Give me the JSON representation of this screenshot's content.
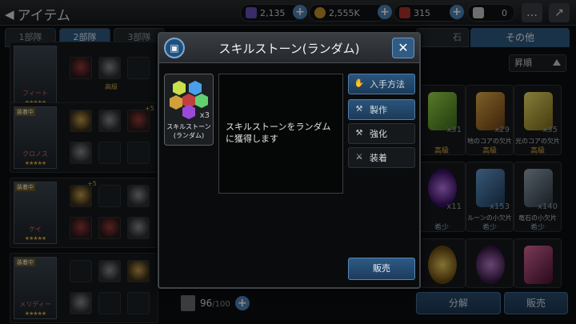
{
  "header": {
    "title": "アイテム",
    "resources": [
      {
        "name": "crystal",
        "value": "2,135",
        "color": "#6a4fc0"
      },
      {
        "name": "gold",
        "value": "2,555K",
        "color": "#c9902c"
      },
      {
        "name": "ruby",
        "value": "315",
        "color": "#b0302c"
      },
      {
        "name": "ticket",
        "value": "0",
        "color": "#c9c9c9"
      }
    ]
  },
  "tabs": {
    "items": [
      "1部隊",
      "2部隊",
      "3部隊"
    ],
    "partial": "石",
    "other": "その他"
  },
  "sort": {
    "label": "昇順"
  },
  "characters": [
    {
      "name": "フィート",
      "tag": "",
      "stars": "★★★★★"
    },
    {
      "name": "クロノス",
      "tag": "装着中",
      "stars": "★★★★★"
    },
    {
      "name": "ケイ",
      "tag": "装着中",
      "stars": "★★★★★"
    },
    {
      "name": "メリディー",
      "tag": "装着中",
      "stars": "★★★★★"
    }
  ],
  "equip_labels": {
    "high": "高級",
    "plus5": "+5"
  },
  "grid": [
    {
      "count": "x31",
      "caption": "",
      "rarity": "高級",
      "color": "#7fbf3a"
    },
    {
      "count": "x29",
      "caption": "地のコアの欠片",
      "rarity": "高級",
      "color": "#c98a2a"
    },
    {
      "count": "x35",
      "caption": "光のコアの欠片",
      "rarity": "高級",
      "color": "#d6c23a"
    },
    {
      "count": "x11",
      "caption": "",
      "rarity": "希少",
      "color": "#8a3ad0"
    },
    {
      "count": "x153",
      "caption": "ルーンの小欠片",
      "rarity": "希少",
      "color": "#3a6aa8"
    },
    {
      "count": "x140",
      "caption": "竜石の小欠片",
      "rarity": "希少",
      "color": "#5a6a7a"
    },
    {
      "count": "",
      "caption": "",
      "rarity": "",
      "color": "#c9a22a"
    },
    {
      "count": "",
      "caption": "",
      "rarity": "",
      "color": "#8a4fb0"
    },
    {
      "count": "",
      "caption": "",
      "rarity": "",
      "color": "#b03a6a"
    }
  ],
  "bottom": {
    "capacity": "96",
    "capacity_max": "/100",
    "disassemble": "分解",
    "sell": "販売"
  },
  "modal": {
    "title": "スキルストーン(ランダム)",
    "item_name": "スキルストーン(ランダム)",
    "item_qty": "x3",
    "description": "スキルストーンをランダムに獲得します",
    "buttons": {
      "obtain": "入手方法",
      "craft": "製作",
      "enhance": "強化",
      "equip": "装着",
      "sell": "販売"
    }
  }
}
